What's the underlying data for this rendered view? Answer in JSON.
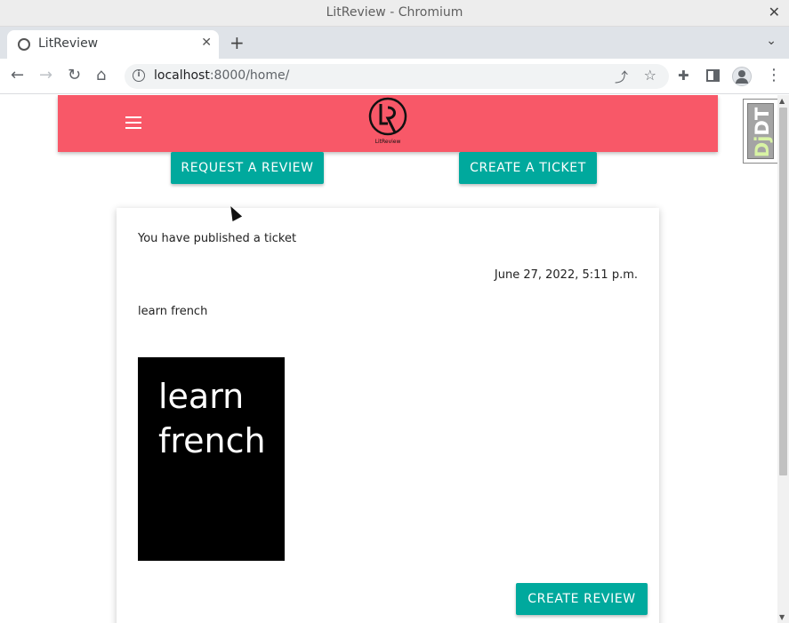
{
  "window": {
    "title": "LitReview - Chromium"
  },
  "tab": {
    "title": "LitReview"
  },
  "address_bar": {
    "host": "localhost",
    "rest": ":8000/home/"
  },
  "header": {
    "logo_text": "LitReview"
  },
  "actions": {
    "request_review": "REQUEST A REVIEW",
    "create_ticket": "CREATE A TICKET"
  },
  "post": {
    "headline": "You have published a ticket",
    "date": "June 27, 2022, 5:11 p.m.",
    "title": "learn french",
    "image_text_line1": "learn",
    "image_text_line2": "french",
    "create_review": "CREATE REVIEW"
  },
  "debug_toolbar": {
    "label_dj": "Dj",
    "label_dt": "DT"
  },
  "icons": [
    "close-icon",
    "favicon-icon",
    "new-tab-icon",
    "back-icon",
    "forward-icon",
    "reload-icon",
    "home-icon",
    "site-info-icon",
    "share-icon",
    "bookmark-star-icon",
    "extensions-icon",
    "side-panel-icon",
    "profile-icon",
    "kebab-menu-icon",
    "hamburger-icon"
  ],
  "colors": {
    "header": "#f85868",
    "button": "#00a99d"
  }
}
